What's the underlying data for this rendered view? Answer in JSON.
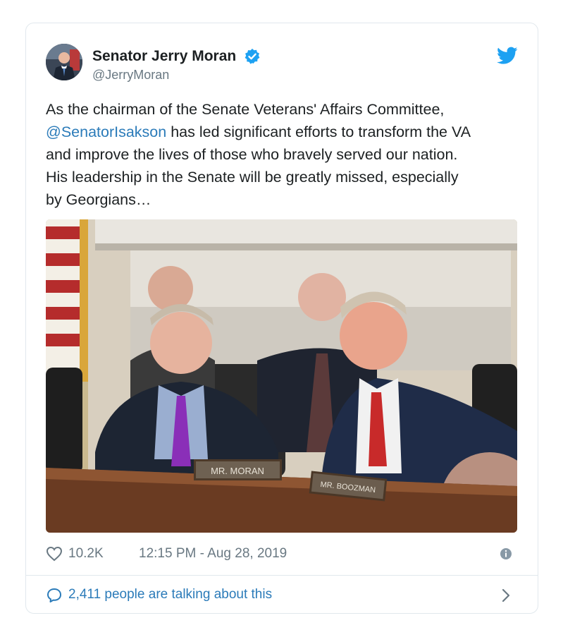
{
  "tweet": {
    "display_name": "Senator Jerry Moran",
    "handle": "@JerryMoran",
    "text_before": "As the chairman of the Senate Veterans' Affairs Committee,\n",
    "mention": "@SenatorIsakson",
    "text_after": " has led significant efforts to transform the VA\nand improve the lives of those who bravely served our nation.\nHis leadership in the Senate will be greatly missed, especially\nby Georgians…",
    "likes": "10.2K",
    "timestamp": "12:15 PM - Aug 28, 2019",
    "talking": "2,411 people are talking about this"
  },
  "photo": {
    "nameplate_left": "MR. MORAN",
    "nameplate_right": "MR. BOOZMAN"
  },
  "colors": {
    "link": "#2b7bb9",
    "twitter_blue": "#1da1f2",
    "muted": "#697882",
    "verified": "#1da1f2"
  },
  "icons": [
    "verified-icon",
    "twitter-bird-icon",
    "heart-icon",
    "info-icon",
    "chat-bubble-icon",
    "chevron-right-icon"
  ]
}
